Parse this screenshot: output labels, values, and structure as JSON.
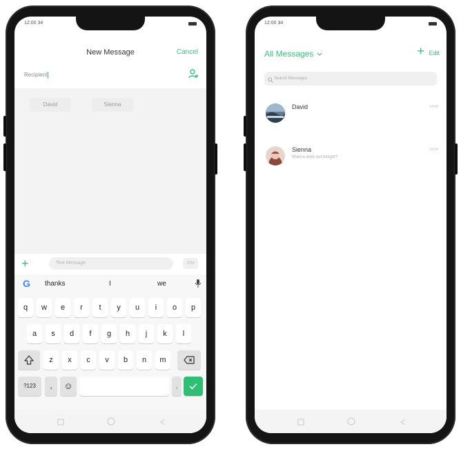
{
  "colors": {
    "accent": "#3bbf7c",
    "send_key": "#2fbf74"
  },
  "left_phone": {
    "status": {
      "time": "12:00 34"
    },
    "header": {
      "title": "New Message",
      "cancel": "Cancel"
    },
    "recipient": {
      "label": "Recipient"
    },
    "suggestions": [
      "David",
      "Sienna"
    ],
    "compose": {
      "placeholder": "Text Message",
      "send_label": "SIM"
    },
    "keyboard": {
      "suggestions": [
        "thanks",
        "I",
        "we"
      ],
      "row1": [
        "q",
        "w",
        "e",
        "r",
        "t",
        "y",
        "u",
        "i",
        "o",
        "p"
      ],
      "row2": [
        "a",
        "s",
        "d",
        "f",
        "g",
        "h",
        "j",
        "k",
        "l"
      ],
      "row3": [
        "z",
        "x",
        "c",
        "v",
        "b",
        "n",
        "m"
      ],
      "bottom": {
        "symbols": "?123",
        "comma": ",",
        "period": "."
      }
    }
  },
  "right_phone": {
    "status": {
      "time": "12:00 34"
    },
    "header": {
      "title": "All Messages",
      "edit": "Edit"
    },
    "search": {
      "placeholder": "Search Messages"
    },
    "conversations": [
      {
        "name": "David",
        "preview": "",
        "time": "14:00"
      },
      {
        "name": "Sienna",
        "preview": "Wanna work out tonight?",
        "time": "13:04"
      }
    ]
  }
}
